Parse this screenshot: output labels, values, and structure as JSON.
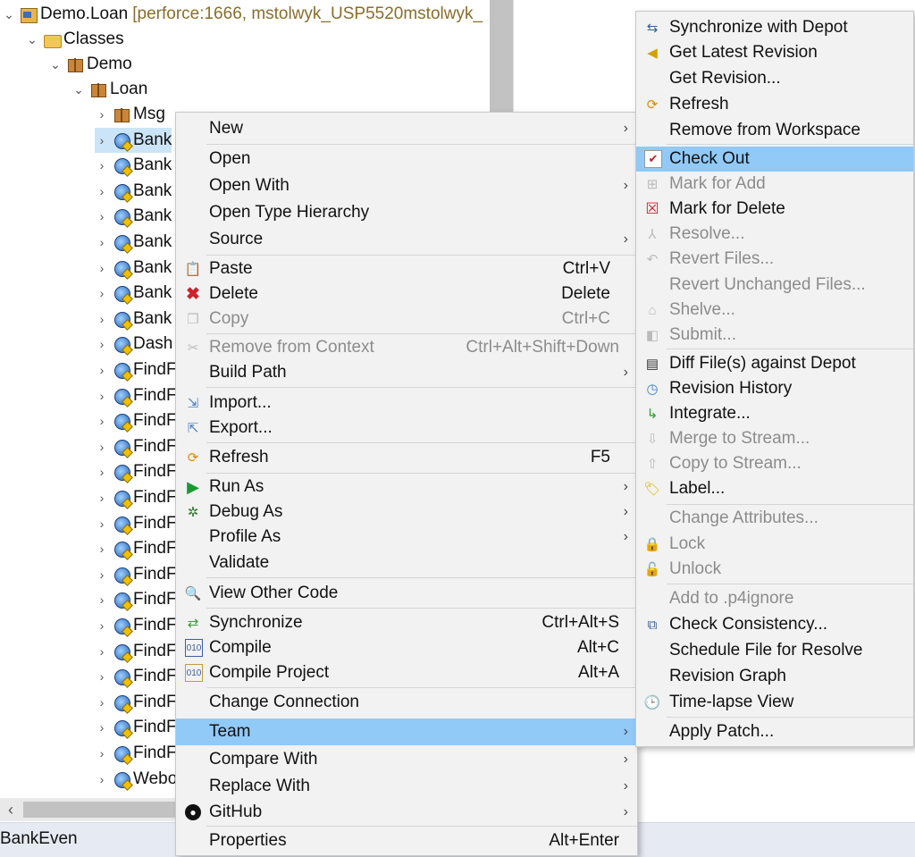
{
  "tree": {
    "project": {
      "name": "Demo.Loan",
      "decoration": "[perforce:1666, mstolwyk_USP5520mstolwyk_"
    },
    "classes": "Classes",
    "demo": "Demo",
    "loan": "Loan",
    "items": [
      "Msg",
      "Bank",
      "Bank",
      "Bank",
      "Bank",
      "Bank",
      "Bank",
      "Bank",
      "Bank",
      "Dash",
      "FindF",
      "FindF",
      "FindF",
      "FindF",
      "FindF",
      "FindF",
      "FindF",
      "FindF",
      "FindF",
      "FindF",
      "FindF",
      "FindF",
      "FindF",
      "FindF",
      "FindF",
      "FindF",
      "Webo"
    ]
  },
  "status_bar": {
    "text": "BankEven"
  },
  "context_menu": {
    "new": "New",
    "open": "Open",
    "open_with": "Open With",
    "open_type_hierarchy": "Open Type Hierarchy",
    "source": "Source",
    "paste": "Paste",
    "paste_sc": "Ctrl+V",
    "delete": "Delete",
    "delete_sc": "Delete",
    "copy": "Copy",
    "copy_sc": "Ctrl+C",
    "remove_from_context": "Remove from Context",
    "remove_from_context_sc": "Ctrl+Alt+Shift+Down",
    "build_path": "Build Path",
    "import": "Import...",
    "export": "Export...",
    "refresh": "Refresh",
    "refresh_sc": "F5",
    "run_as": "Run As",
    "debug_as": "Debug As",
    "profile_as": "Profile As",
    "validate": "Validate",
    "view_other_code": "View Other Code",
    "synchronize": "Synchronize",
    "synchronize_sc": "Ctrl+Alt+S",
    "compile": "Compile",
    "compile_sc": "Alt+C",
    "compile_project": "Compile Project",
    "compile_project_sc": "Alt+A",
    "change_connection": "Change Connection",
    "team": "Team",
    "compare_with": "Compare With",
    "replace_with": "Replace With",
    "github": "GitHub",
    "properties": "Properties",
    "properties_sc": "Alt+Enter"
  },
  "team_menu": {
    "synchronize_with_depot": "Synchronize with Depot",
    "get_latest_revision": "Get Latest Revision",
    "get_revision": "Get Revision...",
    "refresh": "Refresh",
    "remove_from_workspace": "Remove from Workspace",
    "check_out": "Check Out",
    "mark_for_add": "Mark for Add",
    "mark_for_delete": "Mark for Delete",
    "resolve": "Resolve...",
    "revert_files": "Revert Files...",
    "revert_unchanged_files": "Revert Unchanged Files...",
    "shelve": "Shelve...",
    "submit": "Submit...",
    "diff_against_depot": "Diff File(s) against Depot",
    "revision_history": "Revision History",
    "integrate": "Integrate...",
    "merge_to_stream": "Merge to Stream...",
    "copy_to_stream": "Copy to Stream...",
    "label": "Label...",
    "change_attributes": "Change Attributes...",
    "lock": "Lock",
    "unlock": "Unlock",
    "add_to_p4ignore": "Add to .p4ignore",
    "check_consistency": "Check Consistency...",
    "schedule_file_for_resolve": "Schedule File for Resolve",
    "revision_graph": "Revision Graph",
    "time_lapse_view": "Time-lapse View",
    "apply_patch": "Apply Patch..."
  }
}
